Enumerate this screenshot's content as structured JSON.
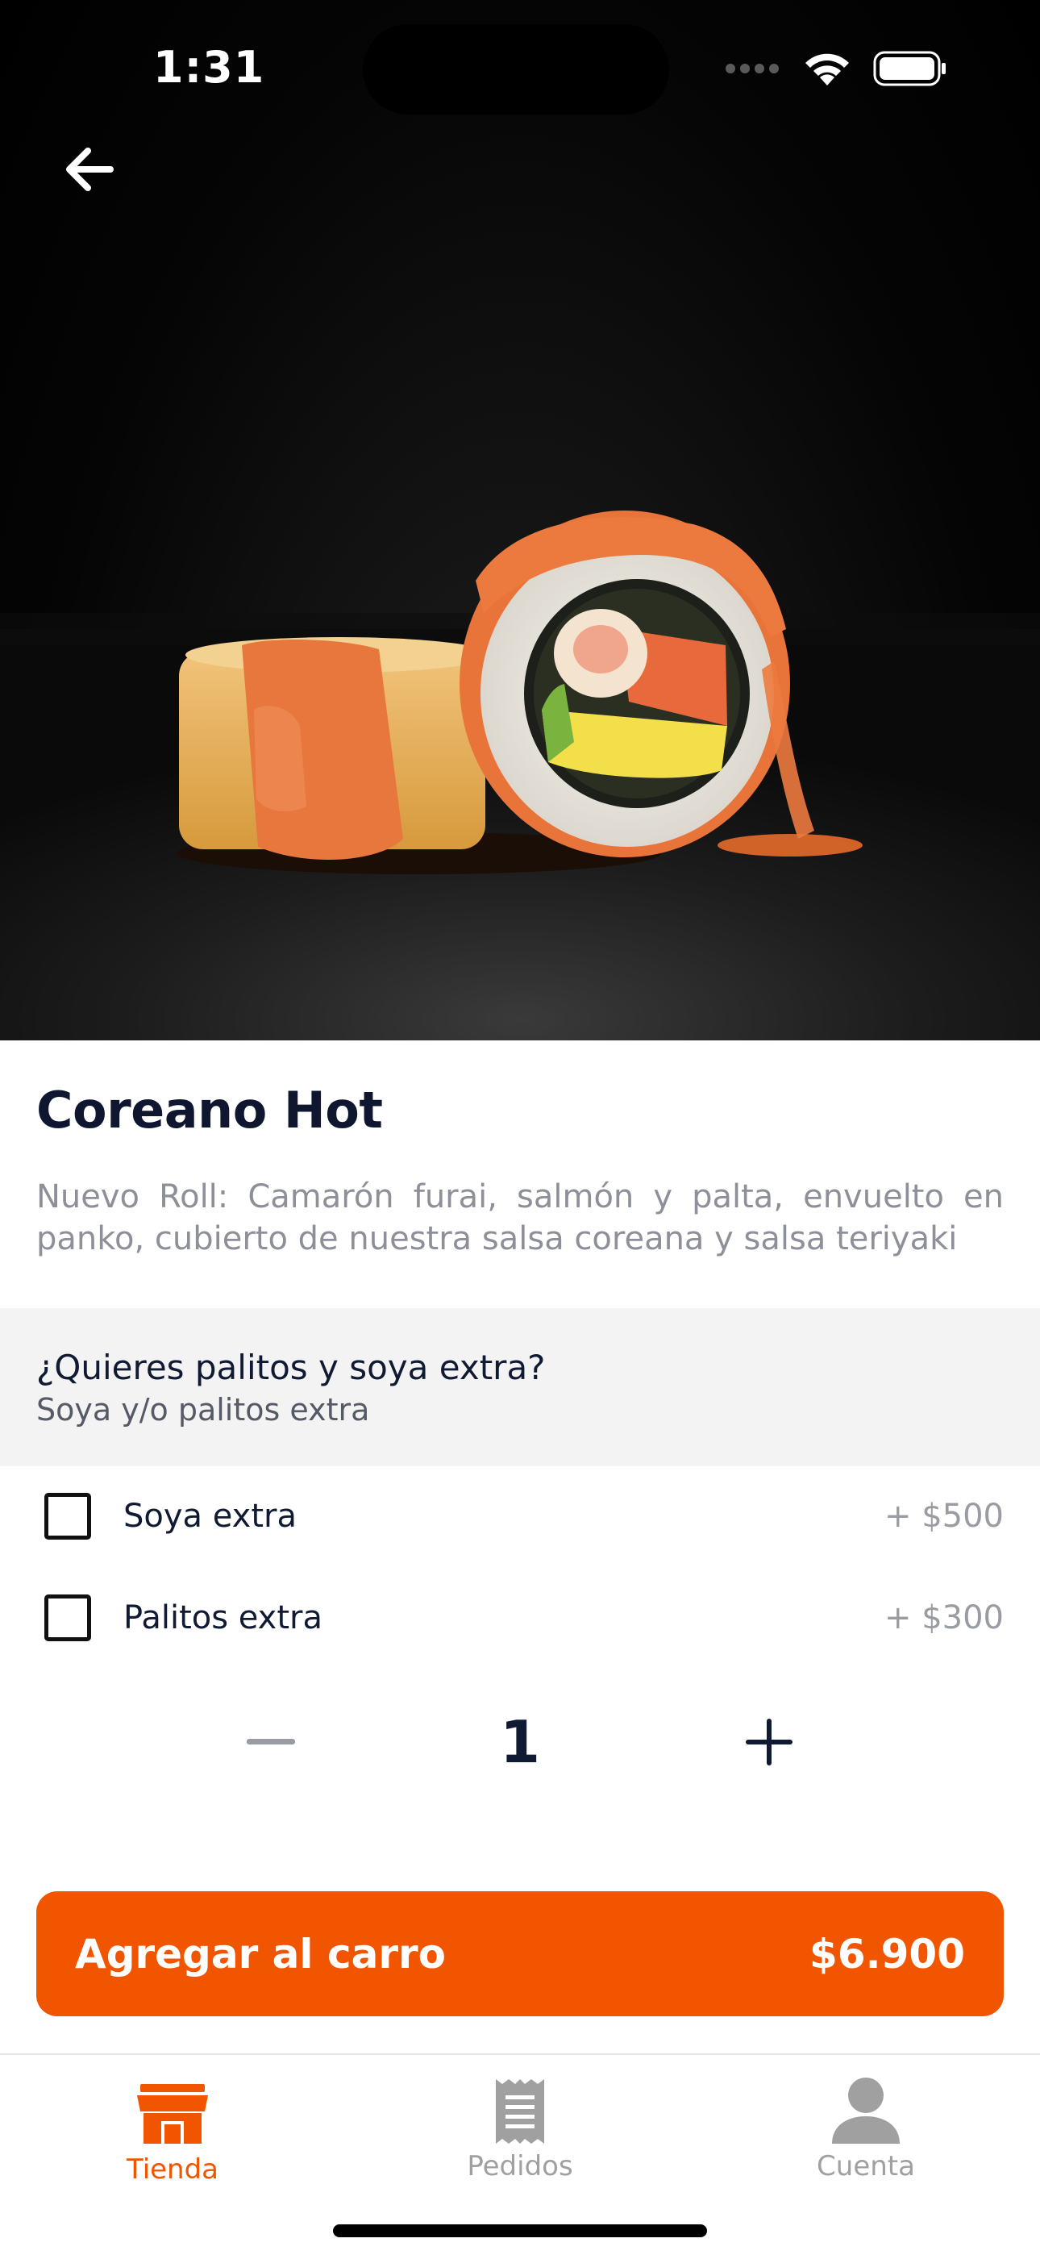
{
  "status_bar": {
    "time": "1:31"
  },
  "product": {
    "title": "Coreano Hot",
    "description": "Nuevo Roll: Camarón furai, salmón y palta, envuelto en panko, cubierto de nuestra salsa coreana y salsa teriyaki"
  },
  "extras_section": {
    "title": "¿Quieres palitos y soya extra?",
    "subtitle": "Soya y/o palitos extra",
    "options": [
      {
        "label": "Soya extra",
        "price": "+ $500",
        "checked": false
      },
      {
        "label": "Palitos extra",
        "price": "+ $300",
        "checked": false
      }
    ]
  },
  "quantity": {
    "value": "1"
  },
  "cta": {
    "label": "Agregar al carro",
    "price": "$6.900"
  },
  "tabs": [
    {
      "label": "Tienda",
      "icon": "store-icon",
      "active": true
    },
    {
      "label": "Pedidos",
      "icon": "receipt-icon",
      "active": false
    },
    {
      "label": "Cuenta",
      "icon": "user-icon",
      "active": false
    }
  ],
  "colors": {
    "accent": "#f25500",
    "text_dark": "#111a33",
    "muted": "#8d9099",
    "inactive_tab": "#a0a0a0"
  }
}
